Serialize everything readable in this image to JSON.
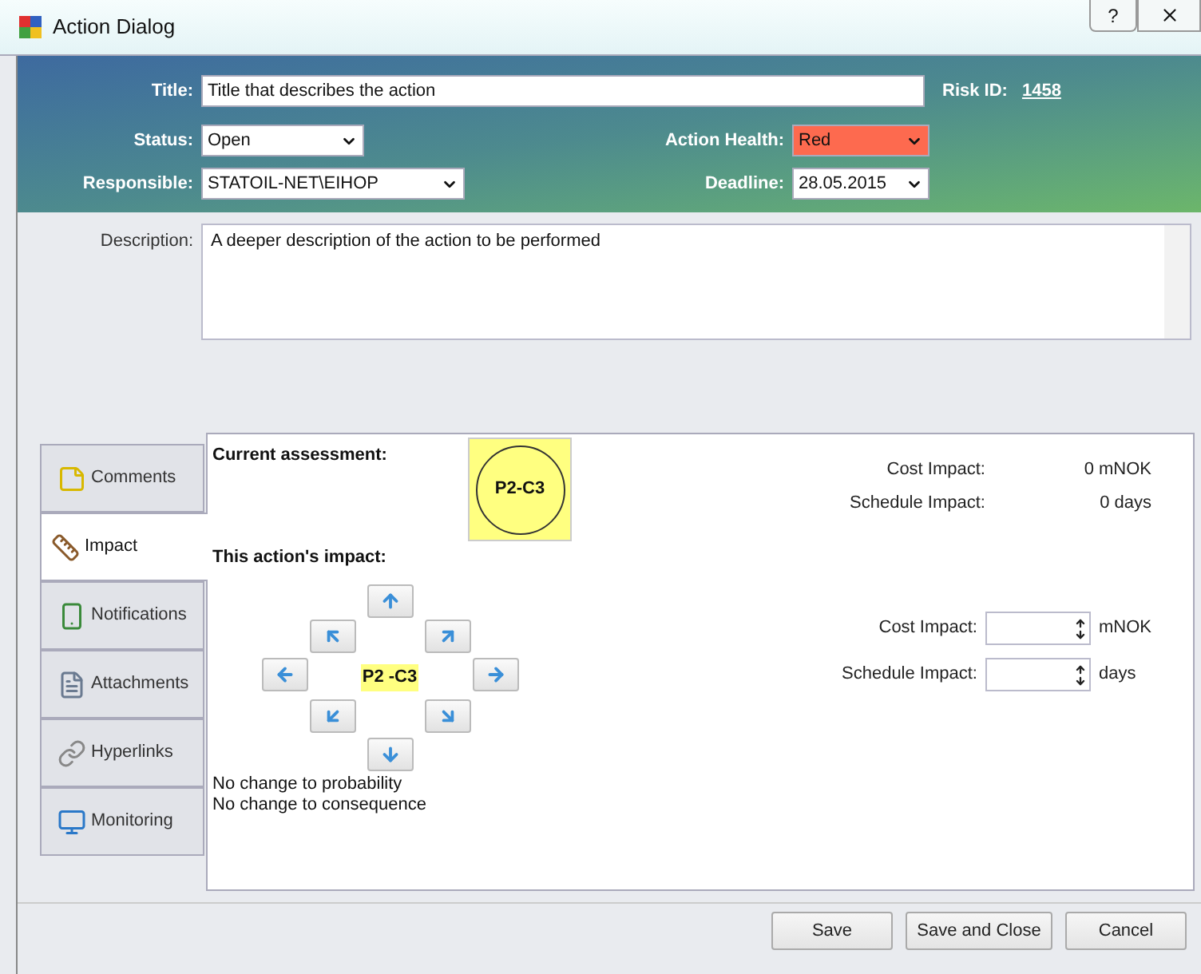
{
  "window": {
    "title": "Action Dialog",
    "help": "?"
  },
  "header": {
    "title_label": "Title:",
    "title_value": "Title that describes the action",
    "risk_label": "Risk ID:",
    "risk_id": "1458",
    "status_label": "Status:",
    "status_value": "Open",
    "health_label": "Action Health:",
    "health": {
      "value": "Red",
      "color": "#fd6a4f"
    },
    "responsible_label": "Responsible:",
    "responsible_value": "STATOIL-NET\\EIHOP",
    "deadline_label": "Deadline:",
    "deadline_value": "28.05.2015"
  },
  "description": {
    "label": "Description:",
    "value": "A deeper description of the action to be performed"
  },
  "tabs": [
    {
      "label": "Comments",
      "selected": false
    },
    {
      "label": "Impact",
      "selected": true
    },
    {
      "label": "Notifications",
      "selected": false
    },
    {
      "label": "Attachments",
      "selected": false
    },
    {
      "label": "Hyperlinks",
      "selected": false
    },
    {
      "label": "Monitoring",
      "selected": false
    }
  ],
  "impact": {
    "current_label": "Current assessment:",
    "current_code": "P2-C3",
    "current_rows": [
      {
        "label": "Cost Impact:",
        "value": "0 mNOK"
      },
      {
        "label": "Schedule Impact:",
        "value": "0 days"
      }
    ],
    "action_label": "This action's impact:",
    "action_code": "P2 -C3",
    "notes": [
      "No change to probability",
      "No change to consequence"
    ],
    "input_rows": [
      {
        "label": "Cost Impact:",
        "unit": "mNOK"
      },
      {
        "label": "Schedule Impact:",
        "unit": "days"
      }
    ]
  },
  "buttons": [
    "Save",
    "Save and Close",
    "Cancel"
  ]
}
